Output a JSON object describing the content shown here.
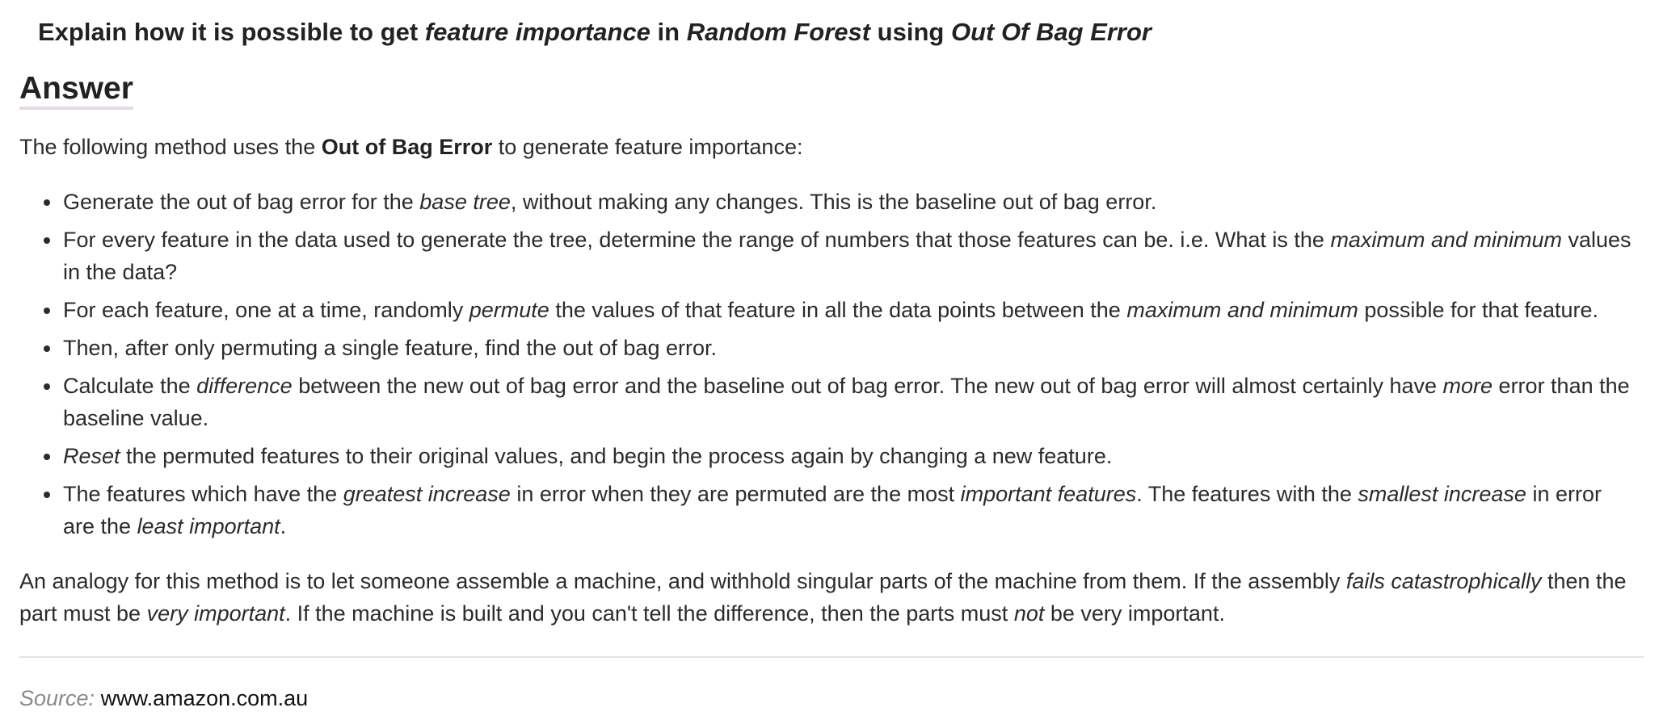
{
  "question": {
    "parts": [
      {
        "text": "Explain how it is possible to get ",
        "italic": false
      },
      {
        "text": "feature importance",
        "italic": true
      },
      {
        "text": " in ",
        "italic": false
      },
      {
        "text": "Random Forest",
        "italic": true
      },
      {
        "text": " using ",
        "italic": false
      },
      {
        "text": "Out Of Bag Error",
        "italic": true
      }
    ]
  },
  "answer_heading": "Answer",
  "intro": {
    "before": "The following method uses the ",
    "bold": "Out of Bag Error",
    "after": " to generate feature importance:"
  },
  "steps": [
    [
      {
        "text": "Generate the out of bag error for the ",
        "italic": false
      },
      {
        "text": "base tree",
        "italic": true
      },
      {
        "text": ", without making any changes. This is the baseline out of bag error.",
        "italic": false
      }
    ],
    [
      {
        "text": "For every feature in the data used to generate the tree, determine the range of numbers that those features can be. i.e. What is the ",
        "italic": false
      },
      {
        "text": "maximum and minimum",
        "italic": true
      },
      {
        "text": " values in the data?",
        "italic": false
      }
    ],
    [
      {
        "text": "For each feature, one at a time, randomly ",
        "italic": false
      },
      {
        "text": "permute",
        "italic": true
      },
      {
        "text": " the values of that feature in all the data points between the ",
        "italic": false
      },
      {
        "text": "maximum and minimum",
        "italic": true
      },
      {
        "text": " possible for that feature.",
        "italic": false
      }
    ],
    [
      {
        "text": "Then, after only permuting a single feature, find the out of bag error.",
        "italic": false
      }
    ],
    [
      {
        "text": "Calculate the ",
        "italic": false
      },
      {
        "text": "difference",
        "italic": true
      },
      {
        "text": " between the new out of bag error and the baseline out of bag error. The new out of bag error will almost certainly have ",
        "italic": false
      },
      {
        "text": "more",
        "italic": true
      },
      {
        "text": " error than the baseline value.",
        "italic": false
      }
    ],
    [
      {
        "text": "Reset",
        "italic": true
      },
      {
        "text": " the permuted features to their original values, and begin the process again by changing a new feature.",
        "italic": false
      }
    ],
    [
      {
        "text": "The features which have the ",
        "italic": false
      },
      {
        "text": "greatest increase",
        "italic": true
      },
      {
        "text": " in error when they are permuted are the most ",
        "italic": false
      },
      {
        "text": "important features",
        "italic": true
      },
      {
        "text": ". The features with the ",
        "italic": false
      },
      {
        "text": "smallest increase",
        "italic": true
      },
      {
        "text": " in error are the ",
        "italic": false
      },
      {
        "text": "least important",
        "italic": true
      },
      {
        "text": ".",
        "italic": false
      }
    ]
  ],
  "analogy": [
    {
      "text": "An analogy for this method is to let someone assemble a machine, and withhold singular parts of the machine from them. If the assembly ",
      "italic": false
    },
    {
      "text": "fails catastrophically",
      "italic": true
    },
    {
      "text": " then the part must be ",
      "italic": false
    },
    {
      "text": "very important",
      "italic": true
    },
    {
      "text": ". If the machine is built and you can't tell the difference, then the parts must ",
      "italic": false
    },
    {
      "text": "not",
      "italic": true
    },
    {
      "text": " be very important.",
      "italic": false
    }
  ],
  "source": {
    "label": "Source:",
    "url": "www.amazon.com.au"
  },
  "colors": {
    "text": "#2b2b2b",
    "heading_underline": "#ead7e6",
    "source_label": "#8a8a8a",
    "divider": "#e3e3e3"
  }
}
